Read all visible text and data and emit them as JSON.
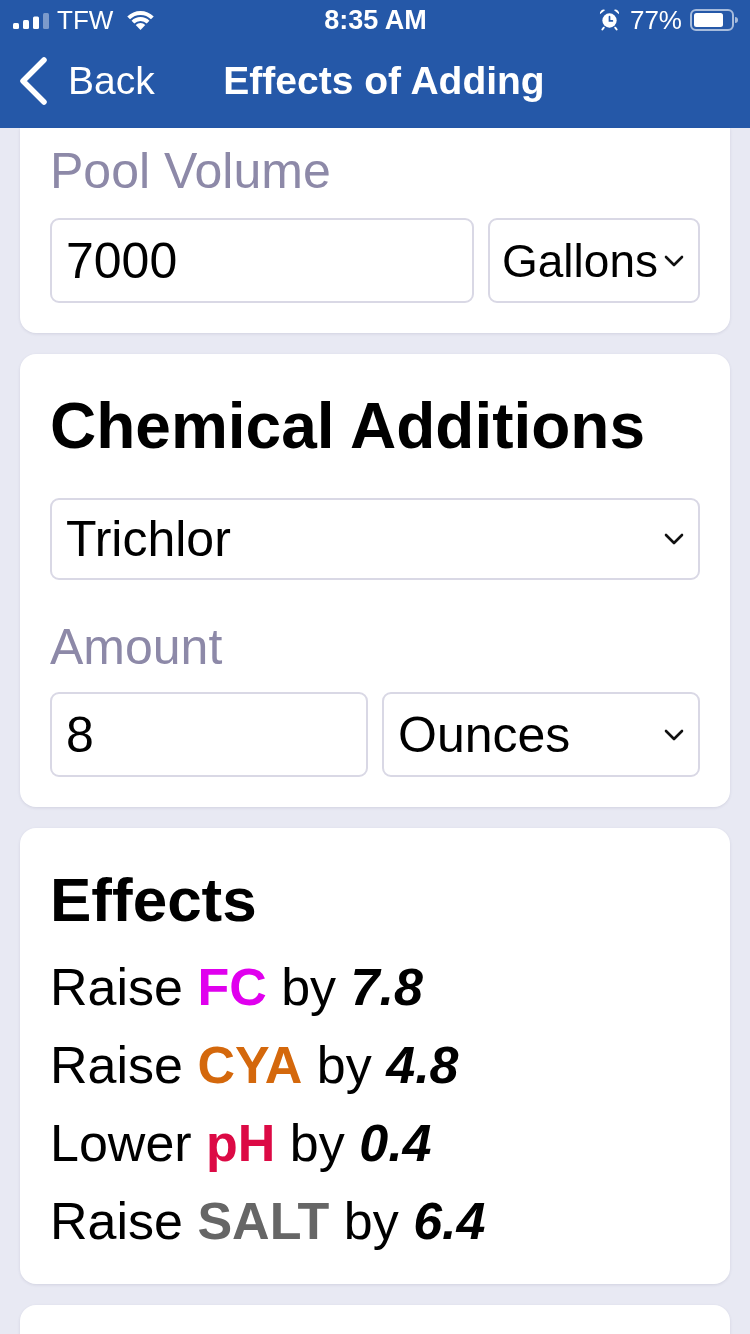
{
  "status_bar": {
    "carrier": "TFW",
    "time": "8:35 AM",
    "battery": "77%"
  },
  "nav_bar": {
    "back": "Back",
    "title": "Effects of Adding"
  },
  "pool_volume": {
    "label": "Pool Volume",
    "value": "7000",
    "unit": "Gallons"
  },
  "chemical_additions": {
    "title": "Chemical Additions",
    "chemical": "Trichlor",
    "amount_label": "Amount",
    "amount": "8",
    "unit": "Ounces"
  },
  "effects": {
    "title": "Effects",
    "items": [
      {
        "direction": "Raise",
        "parameter": "FC",
        "color": "#e000ee",
        "connector": "by",
        "amount": "7.8"
      },
      {
        "direction": "Raise",
        "parameter": "CYA",
        "color": "#d4680c",
        "connector": "by",
        "amount": "4.8"
      },
      {
        "direction": "Lower",
        "parameter": "pH",
        "color": "#dc0a45",
        "connector": "by",
        "amount": "0.4"
      },
      {
        "direction": "Raise",
        "parameter": "SALT",
        "color": "#666666",
        "connector": "by",
        "amount": "6.4"
      }
    ]
  }
}
